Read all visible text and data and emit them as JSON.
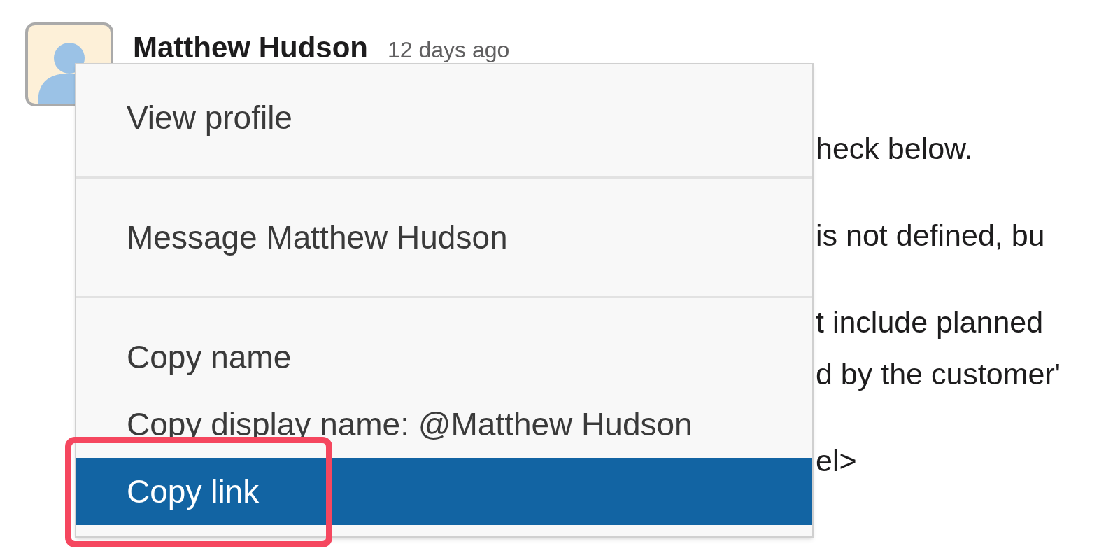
{
  "message": {
    "author": "Matthew Hudson",
    "time": "12 days ago",
    "paragraphs": [
      [
        "heck below."
      ],
      [
        "is not defined, bu"
      ],
      [
        "t include planned",
        "d by the customer'"
      ],
      [
        "el>"
      ]
    ]
  },
  "menu": {
    "items": [
      {
        "kind": "item",
        "label": "View profile",
        "selected": false
      },
      {
        "kind": "divider"
      },
      {
        "kind": "item",
        "label": "Message Matthew Hudson",
        "selected": false
      },
      {
        "kind": "divider"
      },
      {
        "kind": "item",
        "label": "Copy name",
        "selected": false
      },
      {
        "kind": "item",
        "label": "Copy display name: @Matthew Hudson",
        "selected": false
      },
      {
        "kind": "item",
        "label": "Copy link",
        "selected": true,
        "highlighted": true
      }
    ]
  }
}
